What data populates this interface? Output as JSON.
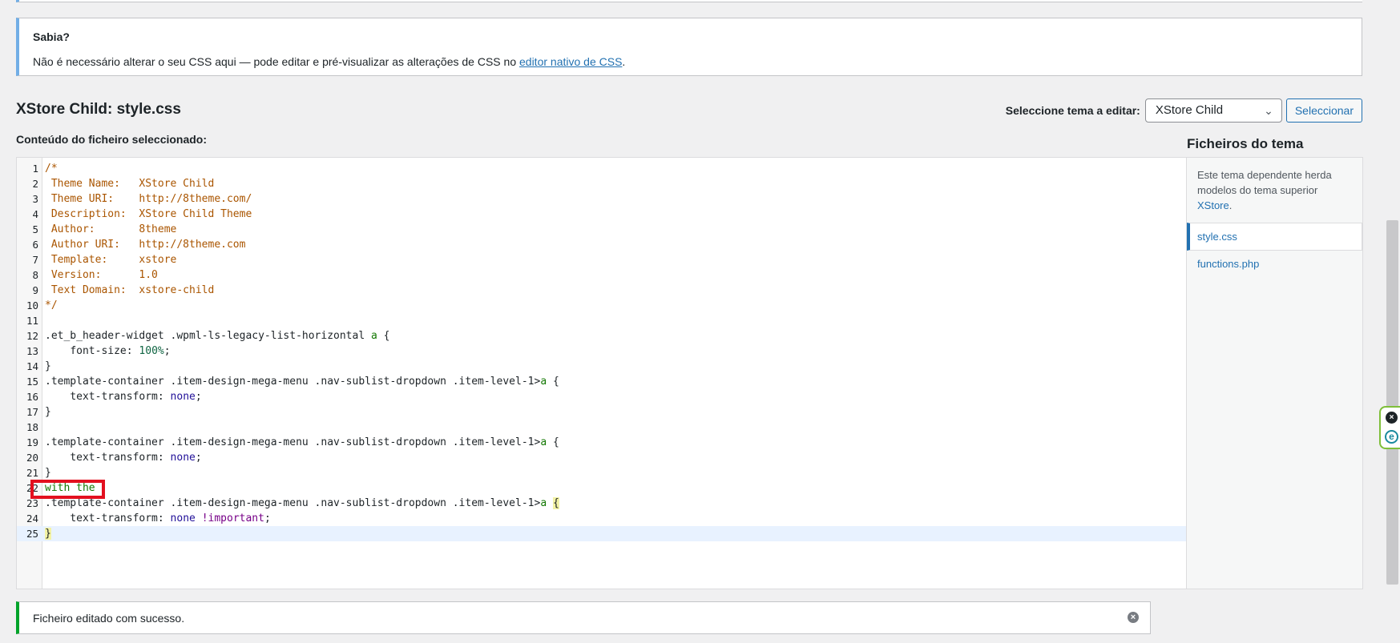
{
  "notice_info": {
    "title": "Sabia?",
    "message_before": "Não é necessário alterar o seu CSS aqui — pode editar e pré-visualizar as alterações de CSS no ",
    "link_text": "editor nativo de CSS",
    "message_after": "."
  },
  "file_title": "XStore Child: style.css",
  "theme_select": {
    "label": "Seleccione tema a editar:",
    "value": "XStore Child",
    "button": "Seleccionar"
  },
  "content_label": "Conteúdo do ficheiro seleccionado:",
  "code": [
    {
      "n": "1",
      "t": "/*"
    },
    {
      "n": "2",
      "t": " Theme Name:   XStore Child"
    },
    {
      "n": "3",
      "t": " Theme URI:    http://8theme.com/"
    },
    {
      "n": "4",
      "t": " Description:  XStore Child Theme"
    },
    {
      "n": "5",
      "t": " Author:       8theme"
    },
    {
      "n": "6",
      "t": " Author URI:   http://8theme.com"
    },
    {
      "n": "7",
      "t": " Template:     xstore"
    },
    {
      "n": "8",
      "t": " Version:      1.0"
    },
    {
      "n": "9",
      "t": " Text Domain:  xstore-child"
    },
    {
      "n": "10",
      "t": "*/"
    },
    {
      "n": "11",
      "t": ""
    },
    {
      "n": "12",
      "t": ".et_b_header-widget .wpml-ls-legacy-list-horizontal a {"
    },
    {
      "n": "13",
      "t": "    font-size: 100%;"
    },
    {
      "n": "14",
      "t": "}"
    },
    {
      "n": "15",
      "t": ".template-container .item-design-mega-menu .nav-sublist-dropdown .item-level-1>a {"
    },
    {
      "n": "16",
      "t": "    text-transform: none;"
    },
    {
      "n": "17",
      "t": "}"
    },
    {
      "n": "18",
      "t": ""
    },
    {
      "n": "19",
      "t": ".template-container .item-design-mega-menu .nav-sublist-dropdown .item-level-1>a {"
    },
    {
      "n": "20",
      "t": "    text-transform: none;"
    },
    {
      "n": "21",
      "t": "}"
    },
    {
      "n": "22",
      "t": "with the"
    },
    {
      "n": "23",
      "t": ".template-container .item-design-mega-menu .nav-sublist-dropdown .item-level-1>a {"
    },
    {
      "n": "24",
      "t": "    text-transform: none !important;"
    },
    {
      "n": "25",
      "t": "}"
    }
  ],
  "files_panel": {
    "title": "Ficheiros do tema",
    "desc_before": "Este tema dependente herda modelos do tema superior ",
    "desc_link": "XStore",
    "desc_after": ".",
    "files": [
      "style.css",
      "functions.php"
    ]
  },
  "notice_success": {
    "message": "Ficheiro editado com sucesso."
  },
  "colors": {
    "accent": "#2271b1",
    "success": "#00a32a",
    "info": "#72aee6",
    "highlight": "#e3101f"
  }
}
